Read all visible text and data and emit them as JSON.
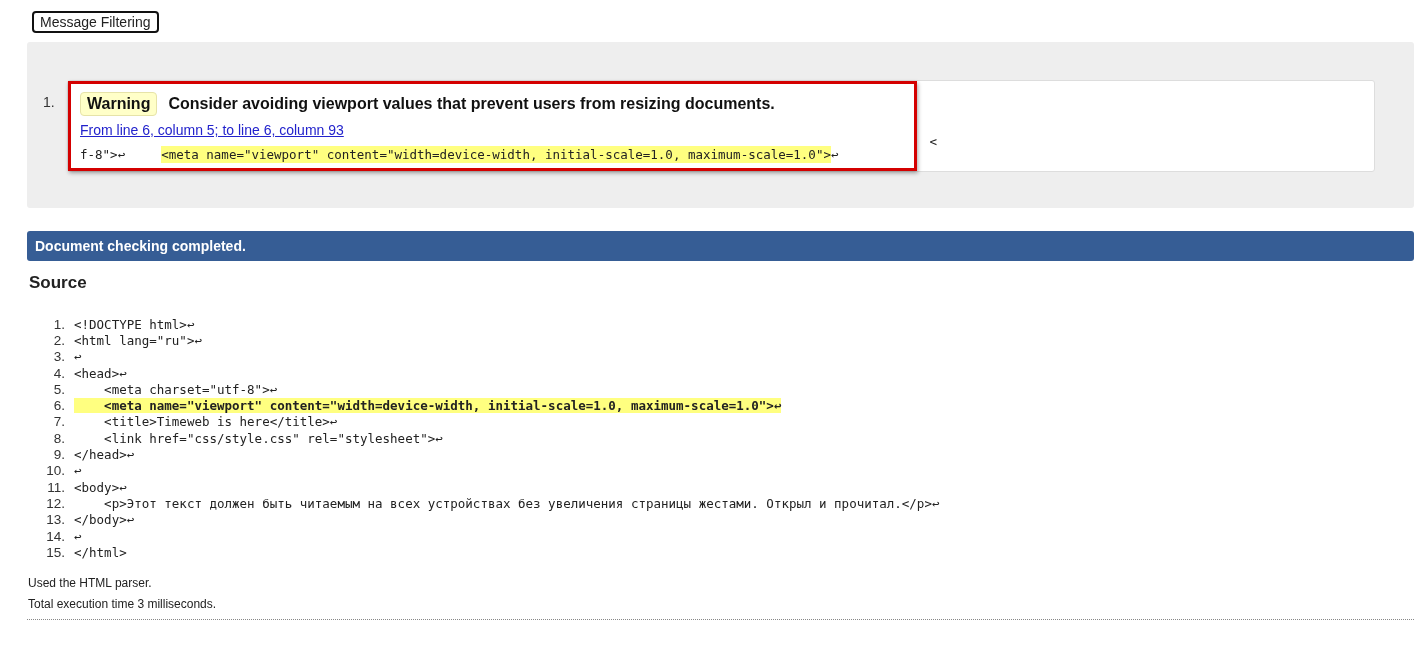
{
  "filter_button": {
    "label": "Message Filtering"
  },
  "messages": [
    {
      "number": "1.",
      "type": "Warning",
      "text": "Consider avoiding viewport values that prevent users from resizing documents.",
      "location": "From line 6, column 5; to line 6, column 93",
      "outlined": true,
      "extract": [
        {
          "text": "f-8\">↩",
          "highlighted": false
        },
        {
          "text": "<meta name=\"viewport\" content=\"width=device-width, initial-scale=1.0, maximum-scale=1.0\">",
          "highlighted": true
        },
        {
          "text": "↩",
          "highlighted": false
        },
        {
          "text": "<",
          "highlighted": false
        }
      ]
    }
  ],
  "status_bar": {
    "text": "Document checking completed."
  },
  "source": {
    "title": "Source",
    "lines": [
      {
        "number": "1.",
        "code": "<!DOCTYPE html>↩",
        "highlighted": false
      },
      {
        "number": "2.",
        "code": "<html lang=\"ru\">↩",
        "highlighted": false
      },
      {
        "number": "3.",
        "code": "↩",
        "highlighted": false
      },
      {
        "number": "4.",
        "code": "<head>↩",
        "highlighted": false
      },
      {
        "number": "5.",
        "code": "    <meta charset=\"utf-8\">↩",
        "highlighted": false
      },
      {
        "number": "6.",
        "code": "    <meta name=\"viewport\" content=\"width=device-width, initial-scale=1.0, maximum-scale=1.0\">↩",
        "highlighted": true
      },
      {
        "number": "7.",
        "code": "    <title>Timeweb is here</title>↩",
        "highlighted": false
      },
      {
        "number": "8.",
        "code": "    <link href=\"css/style.css\" rel=\"stylesheet\">↩",
        "highlighted": false
      },
      {
        "number": "9.",
        "code": "</head>↩",
        "highlighted": false
      },
      {
        "number": "10.",
        "code": "↩",
        "highlighted": false
      },
      {
        "number": "11.",
        "code": "<body>↩",
        "highlighted": false
      },
      {
        "number": "12.",
        "code": "    <p>Этот текст должен быть читаемым на всех устройствах без увеличения страницы жестами. Открыл и прочитал.</p>↩",
        "highlighted": false
      },
      {
        "number": "13.",
        "code": "</body>↩",
        "highlighted": false
      },
      {
        "number": "14.",
        "code": "↩",
        "highlighted": false
      },
      {
        "number": "15.",
        "code": "</html>",
        "highlighted": false
      }
    ]
  },
  "footer": [
    "Used the HTML parser.",
    "Total execution time 3 milliseconds."
  ]
}
